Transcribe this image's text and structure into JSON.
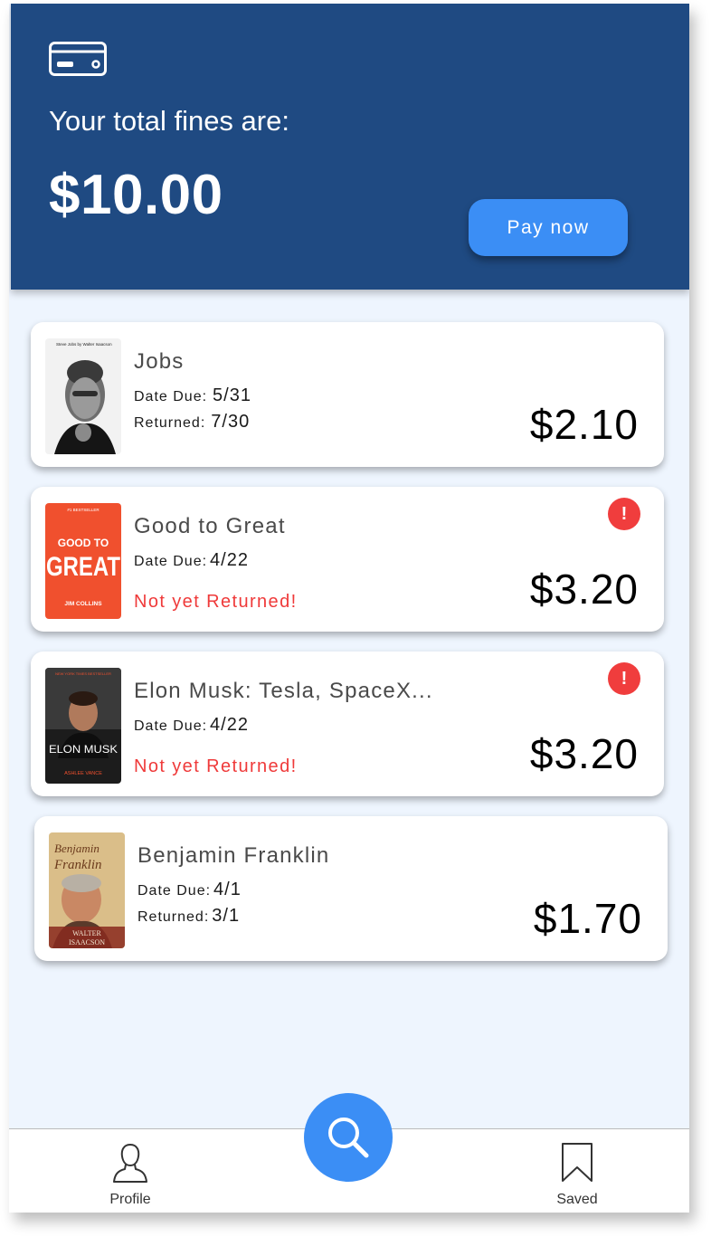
{
  "header": {
    "fines_label": "Your total fines are:",
    "total_fines": "$10.00",
    "pay_label": "Pay now",
    "icon": "credit-card-icon"
  },
  "books": [
    {
      "title": "Jobs",
      "due_label": "Date Due:",
      "due": "5/31",
      "returned_label": "Returned:",
      "returned": "7/30",
      "fine": "$2.10"
    },
    {
      "title": "Good to Great",
      "due_label": "Date Due:",
      "due": "4/22",
      "status": "Not yet Returned!",
      "fine": "$3.20",
      "alert": "!"
    },
    {
      "title": "Elon Musk: Tesla, SpaceX...",
      "due_label": "Date Due:",
      "due": "4/22",
      "status": "Not yet Returned!",
      "fine": "$3.20",
      "alert": "!"
    },
    {
      "title": "Benjamin Franklin",
      "due_label": "Date Due:",
      "due": "4/1",
      "returned_label": "Returned:",
      "returned": "3/1",
      "fine": "$1.70"
    }
  ],
  "covers": [
    {
      "top_text": "Steve Jobs by Walter Isaacson"
    },
    {
      "top_text": "#1 BESTSELLER",
      "main_top": "GOOD TO",
      "main": "GREAT",
      "author": "JIM COLLINS"
    },
    {
      "top_text": "NEW YORK TIMES BESTSELLER",
      "main": "ELON MUSK",
      "author": "ASHLEE VANCE"
    },
    {
      "main_top": "Benjamin",
      "main": "Franklin",
      "author_top": "WALTER",
      "author": "ISAACSON"
    }
  ],
  "nav": {
    "profile_label": "Profile",
    "saved_label": "Saved",
    "icons": [
      "person-icon",
      "search-icon",
      "bookmark-icon"
    ]
  },
  "colors": {
    "header_bg": "#1f4a82",
    "accent": "#3b8ef5",
    "alert": "#f03d3d",
    "page_bg": "#eef5fe"
  }
}
